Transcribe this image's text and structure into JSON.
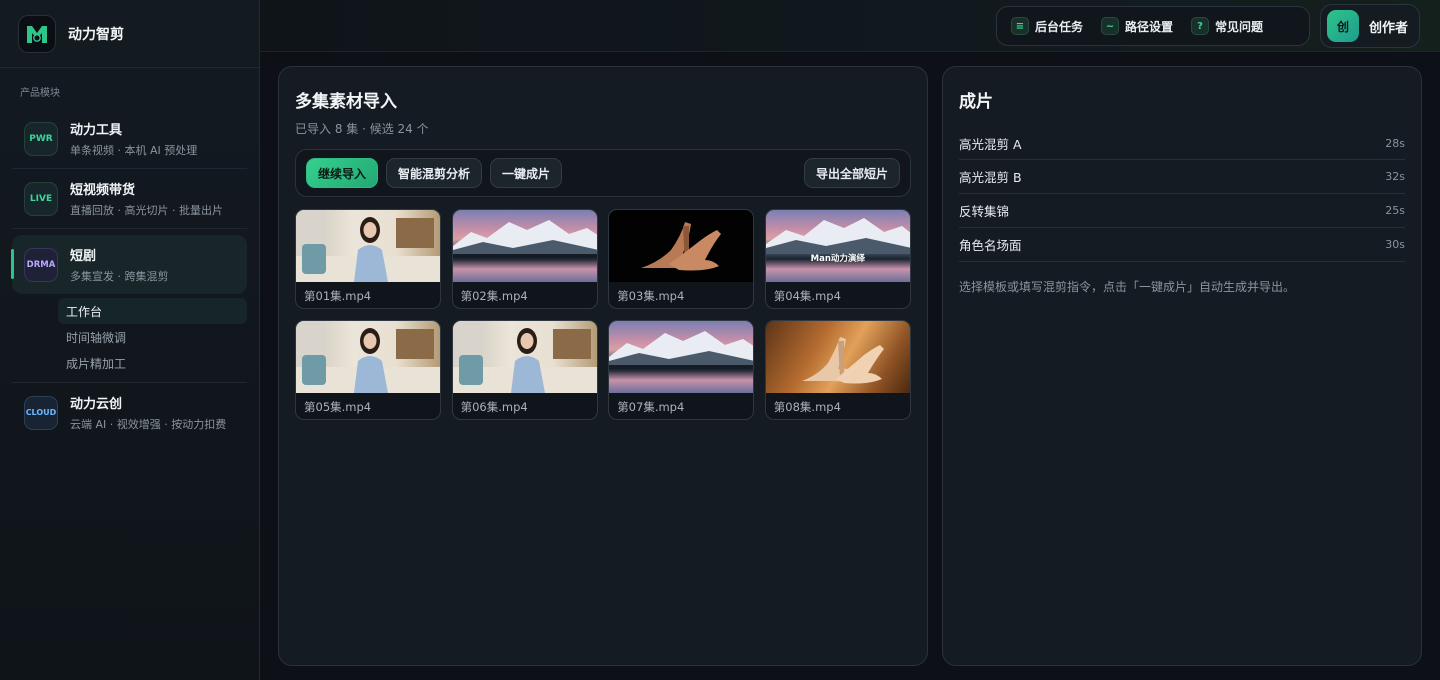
{
  "brand": {
    "name": "动力智剪"
  },
  "sidebar": {
    "section_title": "产品模块",
    "groups": [
      {
        "badge": "PWR",
        "title": "动力工具",
        "sub": "单条视频 · 本机 AI 预处理"
      },
      {
        "badge": "LIVE",
        "title": "短视频带货",
        "sub": "直播回放 · 高光切片 · 批量出片"
      },
      {
        "badge": "DRMA",
        "title": "短剧",
        "sub": "多集宣发 · 跨集混剪"
      },
      {
        "badge": "CLOUD",
        "title": "动力云创",
        "sub": "云端 AI · 视效增强 · 按动力扣费"
      }
    ],
    "subnav": [
      "工作台",
      "时间轴微调",
      "成片精加工"
    ]
  },
  "topbar": {
    "actions": [
      {
        "icon": "≡",
        "label": "后台任务"
      },
      {
        "icon": "~",
        "label": "路径设置"
      },
      {
        "icon": "?",
        "label": "常见问题"
      }
    ],
    "user": {
      "avatar": "创",
      "name": "创作者"
    }
  },
  "import_panel": {
    "title": "多集素材导入",
    "subtitle": "已导入 8 集 · 候选 24 个",
    "buttons": {
      "continue": "继续导入",
      "analyze": "智能混剪分析",
      "one_click": "一键成片",
      "export_all": "导出全部短片"
    },
    "clips": [
      {
        "label": "第01集.mp4",
        "thumb": "woman-sofa"
      },
      {
        "label": "第02集.mp4",
        "thumb": "mountain-lake"
      },
      {
        "label": "第03集.mp4",
        "thumb": "heel-black"
      },
      {
        "label": "第04集.mp4",
        "thumb": "mountain-lake",
        "overlay": "Man动力演绎"
      },
      {
        "label": "第05集.mp4",
        "thumb": "woman-sofa"
      },
      {
        "label": "第06集.mp4",
        "thumb": "woman-sofa"
      },
      {
        "label": "第07集.mp4",
        "thumb": "mountain-lake"
      },
      {
        "label": "第08集.mp4",
        "thumb": "heel-wood"
      }
    ]
  },
  "output_panel": {
    "title": "成片",
    "items": [
      {
        "name": "高光混剪 A",
        "duration": "28s"
      },
      {
        "name": "高光混剪 B",
        "duration": "32s"
      },
      {
        "name": "反转集锦",
        "duration": "25s"
      },
      {
        "name": "角色名场面",
        "duration": "30s"
      }
    ],
    "hint": "选择模板或填写混剪指令，点击「一键成片」自动生成并导出。"
  },
  "colors": {
    "accent": "#2fc48a",
    "background": "#0d1117",
    "panel": "#151b22"
  }
}
